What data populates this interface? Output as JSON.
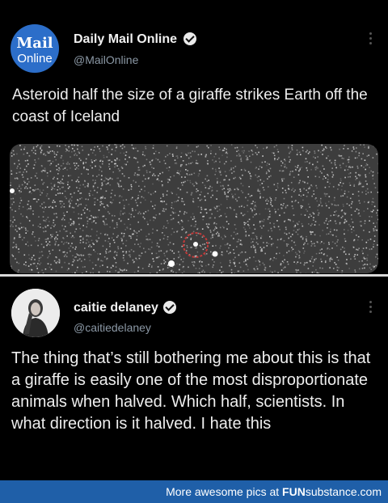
{
  "tweet1": {
    "avatar": {
      "line1": "Mail",
      "line2": "Online"
    },
    "name": "Daily Mail Online",
    "handle": "@MailOnline",
    "text": "Asteroid half the size of a giraffe strikes Earth off the coast of Iceland"
  },
  "tweet2": {
    "name": "caitie delaney",
    "handle": "@caitiedelaney",
    "text": "The thing that’s still bothering me about this is that a giraffe is easily one of the most disproportionate animals when halved. Which half, scientists. In what direction is it halved. I hate this"
  },
  "footer": {
    "prefix": "More awesome pics at ",
    "brand_fun": "FUN",
    "brand_rest": "substance.com"
  },
  "colors": {
    "background": "#000000",
    "footer_bar": "#1f5fa8",
    "mail_blue": "#2c6ec9",
    "handle_gray": "#8b98a5",
    "highlight_circle": "#c23a3a"
  }
}
